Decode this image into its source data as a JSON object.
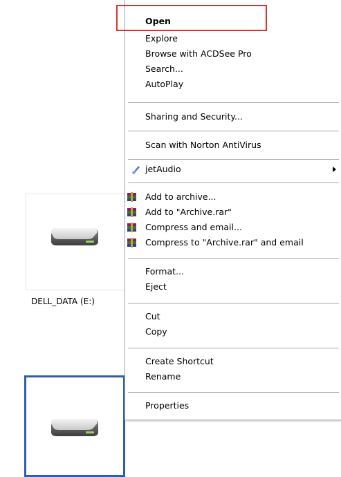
{
  "desktop": {
    "drive_e_label": "DELL_DATA (E:)"
  },
  "context_menu": {
    "items": [
      {
        "label": "Open",
        "bold": true
      },
      {
        "label": "Explore"
      },
      {
        "label": "Browse with ACDSee Pro"
      },
      {
        "label": "Search..."
      },
      {
        "label": "AutoPlay"
      },
      {
        "label": "Sharing and Security..."
      },
      {
        "label": "Scan with Norton AntiVirus"
      },
      {
        "label": "jetAudio",
        "icon": "jetaudio-icon",
        "has_submenu": true
      },
      {
        "label": "Add to archive...",
        "icon": "winrar-icon"
      },
      {
        "label": "Add to \"Archive.rar\"",
        "icon": "winrar-icon"
      },
      {
        "label": "Compress and email...",
        "icon": "winrar-icon"
      },
      {
        "label": "Compress to \"Archive.rar\" and email",
        "icon": "winrar-icon"
      },
      {
        "label": "Format..."
      },
      {
        "label": "Eject"
      },
      {
        "label": "Cut"
      },
      {
        "label": "Copy"
      },
      {
        "label": "Create Shortcut"
      },
      {
        "label": "Rename"
      },
      {
        "label": "Properties"
      }
    ]
  },
  "annotation": {
    "highlight_color": "#e03030",
    "selection_color": "#2e5fa8"
  }
}
